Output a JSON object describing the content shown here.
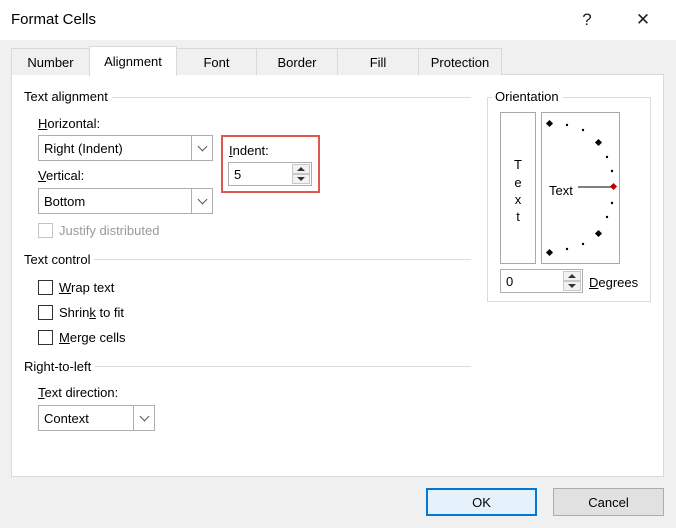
{
  "window": {
    "title": "Format Cells",
    "help": "?",
    "close": "✕"
  },
  "tabs": [
    {
      "label": "Number"
    },
    {
      "label": "Alignment"
    },
    {
      "label": "Font"
    },
    {
      "label": "Border"
    },
    {
      "label": "Fill"
    },
    {
      "label": "Protection"
    }
  ],
  "text_alignment": {
    "section": "Text alignment",
    "horizontal_label": "Horizontal:",
    "horizontal_value": "Right (Indent)",
    "vertical_label": "Vertical:",
    "vertical_value": "Bottom",
    "indent_label": "Indent:",
    "indent_value": "5",
    "justify_distributed": "Justify distributed"
  },
  "text_control": {
    "section": "Text control",
    "wrap": "Wrap text",
    "shrink": "Shrink to fit",
    "merge": "Merge cells"
  },
  "rtl": {
    "section": "Right-to-left",
    "direction_label": "Text direction:",
    "direction_value": "Context"
  },
  "orientation": {
    "section": "Orientation",
    "vertical_text": [
      "T",
      "e",
      "x",
      "t"
    ],
    "dial_text": "Text",
    "degrees_value": "0",
    "degrees_label": "Degrees",
    "indicator_color": "#c00000"
  },
  "buttons": {
    "ok": "OK",
    "cancel": "Cancel"
  },
  "colors": {
    "highlight": "#e0564a",
    "default_button": "#0078d7"
  }
}
